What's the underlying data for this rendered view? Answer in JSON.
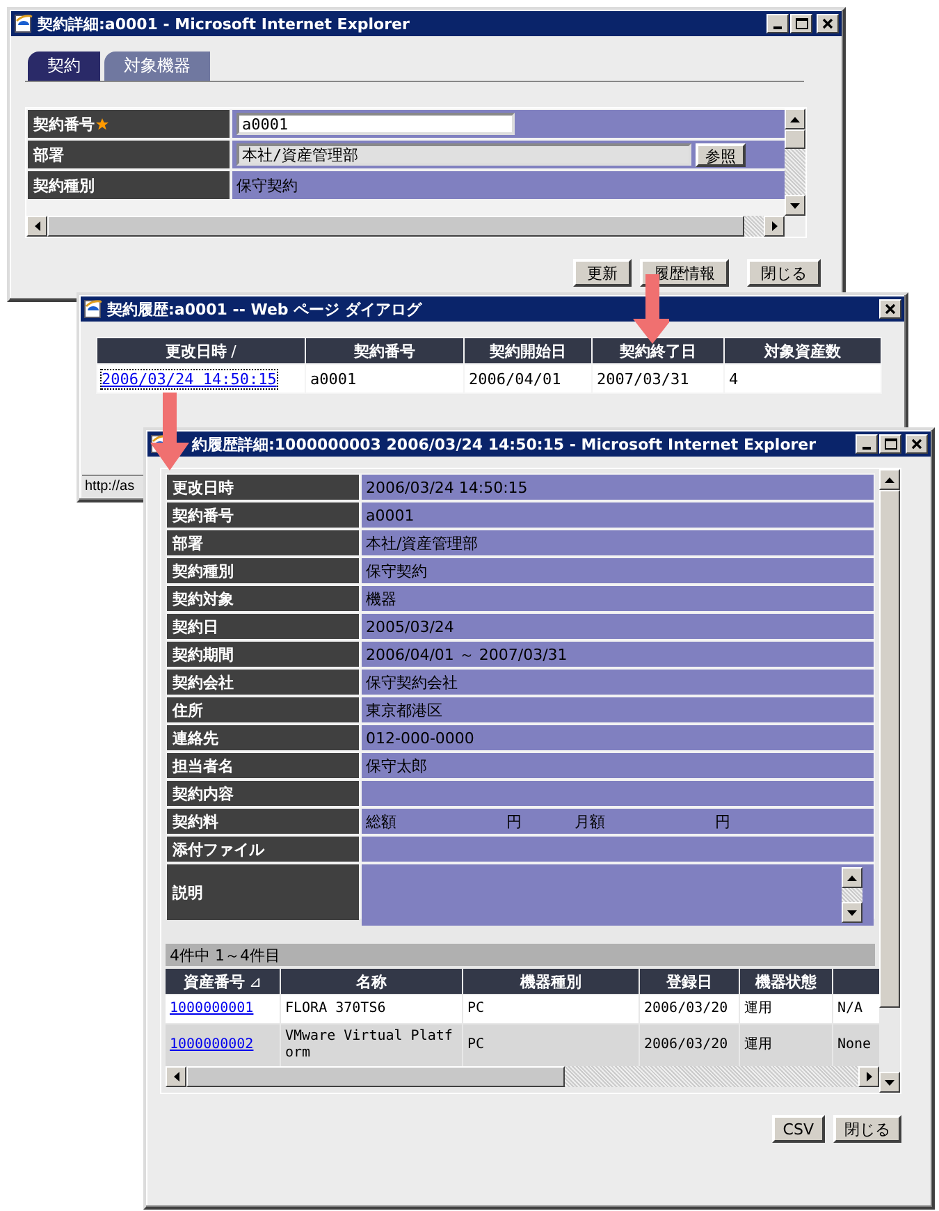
{
  "main_window": {
    "kind": "browser",
    "title": "契約詳細:a0001 - Microsoft Internet Explorer",
    "tabs": [
      {
        "label": "契約",
        "selected": true
      },
      {
        "label": "対象機器",
        "selected": false
      }
    ],
    "fields": [
      {
        "label": "契約番号",
        "required": true,
        "kind": "input",
        "value": "a0001"
      },
      {
        "label": "部署",
        "required": false,
        "kind": "lookup",
        "value": "本社/資産管理部",
        "button": "参照"
      },
      {
        "label": "契約種別",
        "required": false,
        "kind": "text",
        "value": "保守契約"
      }
    ],
    "buttons": [
      "更新",
      "履歴情報",
      "閉じる"
    ]
  },
  "history_dialog": {
    "kind": "dialog",
    "title": "契約履歴:a0001 -- Web ページ ダイアログ",
    "columns": [
      {
        "label": "更改日時",
        "sort_mark": "/",
        "kind": "link"
      },
      {
        "label": "契約番号",
        "kind": "text"
      },
      {
        "label": "契約開始日",
        "kind": "text"
      },
      {
        "label": "契約終了日",
        "kind": "text"
      },
      {
        "label": "対象資産数",
        "kind": "text"
      }
    ],
    "rows": [
      [
        "2006/03/24 14:50:15",
        "a0001",
        "2006/04/01",
        "2007/03/31",
        "4"
      ]
    ],
    "status_bar": "http://as"
  },
  "detail_window": {
    "kind": "browser",
    "title": "約履歴詳細:1000000003 2006/03/24 14:50:15 - Microsoft Internet Explorer",
    "fields": [
      {
        "label": "更改日時",
        "kind": "text",
        "value": "2006/03/24 14:50:15"
      },
      {
        "label": "契約番号",
        "kind": "text",
        "value": "a0001"
      },
      {
        "label": "部署",
        "kind": "text",
        "value": "本社/資産管理部"
      },
      {
        "label": "契約種別",
        "kind": "text",
        "value": "保守契約"
      },
      {
        "label": "契約対象",
        "kind": "text",
        "value": "機器"
      },
      {
        "label": "契約日",
        "kind": "text",
        "value": "2005/03/24"
      },
      {
        "label": "契約期間",
        "kind": "text",
        "value": "2006/04/01 ～ 2007/03/31"
      },
      {
        "label": "契約会社",
        "kind": "text",
        "value": "保守契約会社"
      },
      {
        "label": "住所",
        "kind": "text",
        "value": "東京都港区"
      },
      {
        "label": "連絡先",
        "kind": "text",
        "value": "012-000-0000"
      },
      {
        "label": "担当者名",
        "kind": "text",
        "value": "保守太郎"
      },
      {
        "label": "契約内容",
        "kind": "text"
      },
      {
        "label": "契約料",
        "kind": "fee",
        "parts": [
          "総額",
          "円",
          "月額",
          "円"
        ]
      },
      {
        "label": "添付ファイル",
        "kind": "text"
      },
      {
        "label": "説明",
        "kind": "textarea"
      }
    ],
    "list": {
      "summary": "4件中 1～4件目",
      "columns": [
        {
          "label": "資産番号",
          "sort_mark": "⊿",
          "kind": "link"
        },
        {
          "label": "名称",
          "kind": "text"
        },
        {
          "label": "機器種別",
          "kind": "text"
        },
        {
          "label": "登録日",
          "kind": "text"
        },
        {
          "label": "機器状態",
          "kind": "text"
        },
        {
          "kind": "text"
        }
      ],
      "rows": [
        [
          "1000000001",
          "FLORA 370TS6",
          "PC",
          "2006/03/20",
          "運用",
          "N/A"
        ],
        [
          "1000000002",
          "VMware Virtual Platform",
          "PC",
          "2006/03/20",
          "運用",
          "None"
        ]
      ]
    },
    "buttons": [
      "CSV",
      "閉じる"
    ]
  }
}
